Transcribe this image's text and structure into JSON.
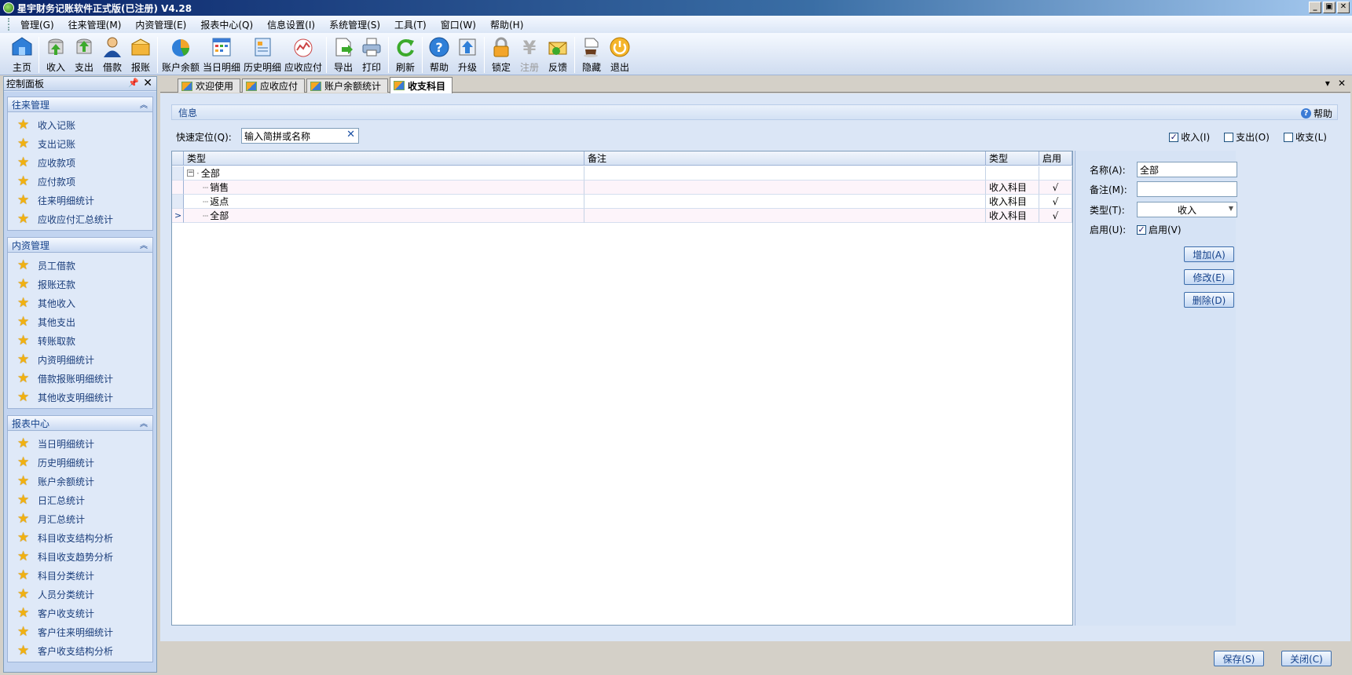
{
  "window": {
    "title": "星宇财务记账软件正式版(已注册) V4.28",
    "controls": [
      "_",
      "▣",
      "✕"
    ]
  },
  "menu": [
    "管理(G)",
    "往来管理(M)",
    "内资管理(E)",
    "报表中心(Q)",
    "信息设置(I)",
    "系统管理(S)",
    "工具(T)",
    "窗口(W)",
    "帮助(H)"
  ],
  "toolbar": [
    {
      "label": "主页",
      "icon": "home-icon"
    },
    {
      "label": "收入",
      "icon": "income-icon"
    },
    {
      "label": "支出",
      "icon": "expense-icon"
    },
    {
      "label": "借款",
      "icon": "borrow-icon"
    },
    {
      "label": "报账",
      "icon": "reimburse-icon"
    },
    {
      "label": "账户余额",
      "icon": "balance-pie-icon"
    },
    {
      "label": "当日明细",
      "icon": "daily-detail-icon"
    },
    {
      "label": "历史明细",
      "icon": "history-detail-icon"
    },
    {
      "label": "应收应付",
      "icon": "receivable-payable-icon"
    },
    {
      "label": "导出",
      "icon": "export-icon"
    },
    {
      "label": "打印",
      "icon": "print-icon"
    },
    {
      "label": "刷新",
      "icon": "refresh-icon"
    },
    {
      "label": "帮助",
      "icon": "help-icon"
    },
    {
      "label": "升级",
      "icon": "upgrade-icon"
    },
    {
      "label": "锁定",
      "icon": "lock-icon"
    },
    {
      "label": "注册",
      "icon": "register-yen-icon"
    },
    {
      "label": "反馈",
      "icon": "feedback-mail-icon"
    },
    {
      "label": "隐藏",
      "icon": "hide-coffee-icon"
    },
    {
      "label": "退出",
      "icon": "exit-power-icon"
    }
  ],
  "panel": {
    "title": "控制面板",
    "groups": [
      {
        "title": "往来管理",
        "items": [
          "收入记账",
          "支出记账",
          "应收款项",
          "应付款项",
          "往来明细统计",
          "应收应付汇总统计"
        ]
      },
      {
        "title": "内资管理",
        "items": [
          "员工借款",
          "报账还款",
          "其他收入",
          "其他支出",
          "转账取款",
          "内资明细统计",
          "借款报账明细统计",
          "其他收支明细统计"
        ]
      },
      {
        "title": "报表中心",
        "items": [
          "当日明细统计",
          "历史明细统计",
          "账户余额统计",
          "日汇总统计",
          "月汇总统计",
          "科目收支结构分析",
          "科目收支趋势分析",
          "科目分类统计",
          "人员分类统计",
          "客户收支统计",
          "客户往来明细统计",
          "客户收支结构分析"
        ]
      }
    ]
  },
  "tabs": [
    "欢迎使用",
    "应收应付",
    "账户余额统计",
    "收支科目"
  ],
  "info": {
    "title": "信息",
    "help": "帮助"
  },
  "search": {
    "label": "快速定位(Q):",
    "value": "输入简拼或名称"
  },
  "filters": [
    {
      "label": "收入(I)",
      "checked": true
    },
    {
      "label": "支出(O)",
      "checked": false
    },
    {
      "label": "收支(L)",
      "checked": false
    }
  ],
  "grid": {
    "columns": [
      "类型",
      "备注",
      "类型",
      "启用"
    ],
    "rows": [
      {
        "name": "全部",
        "note": "",
        "type": "",
        "enabled": ""
      },
      {
        "name": "销售",
        "note": "",
        "type": "收入科目",
        "enabled": "√"
      },
      {
        "name": "返点",
        "note": "",
        "type": "收入科目",
        "enabled": "√"
      },
      {
        "name": "全部",
        "note": "",
        "type": "收入科目",
        "enabled": "√"
      }
    ],
    "current_marker": ">"
  },
  "form": {
    "name_label": "名称(A):",
    "name_value": "全部",
    "note_label": "备注(M):",
    "note_value": "",
    "type_label": "类型(T):",
    "type_value": "收入",
    "enable_label": "启用(U):",
    "enable_check_label": "启用(V)",
    "add": "增加(A)",
    "edit": "修改(E)",
    "delete": "删除(D)"
  },
  "bottom": {
    "save": "保存(S)",
    "close": "关闭(C)"
  }
}
